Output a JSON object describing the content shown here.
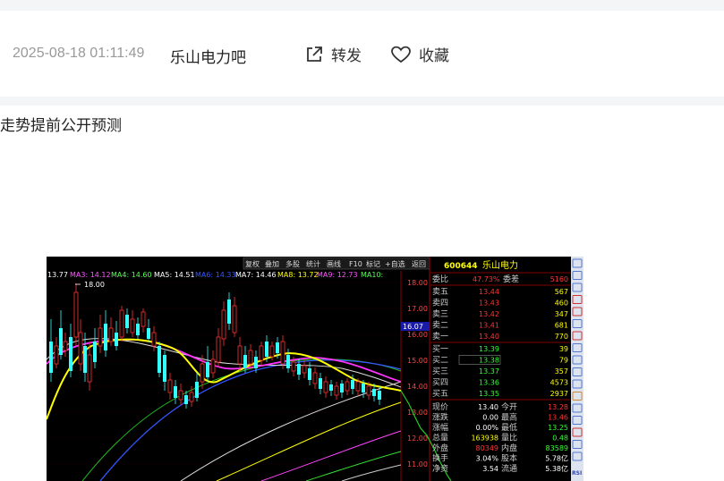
{
  "post": {
    "timestamp": "2025-08-18 01:11:49",
    "author": "乐山电力吧",
    "share_label": "转发",
    "favorite_label": "收藏",
    "text": "走势提前公开预测"
  },
  "stock_panel": {
    "toolbar": [
      "复权",
      "叠加",
      "多股",
      "统计",
      "画线",
      "F10",
      "标记",
      "+自选",
      "返回"
    ],
    "ma_legend": [
      {
        "label": "13.77",
        "color": "#ffffff"
      },
      {
        "label": "MA3: 14.12",
        "color": "#ff55ff"
      },
      {
        "label": "MA4: 14.60",
        "color": "#55ff55"
      },
      {
        "label": "MA5: 14.51",
        "color": "#ffffff"
      },
      {
        "label": "MA6: 14.33",
        "color": "#3355ff"
      },
      {
        "label": "MA7: 14.46",
        "color": "#ffffff"
      },
      {
        "label": "MA8: 13.72",
        "color": "#ffff00"
      },
      {
        "label": "MA9: 12.73",
        "color": "#ff55ff"
      },
      {
        "label": "MA10:",
        "color": "#55ff55"
      }
    ],
    "peak_label": "18.00",
    "current_price_tag": "16.07",
    "y_ticks": [
      "18.00",
      "17.00",
      "16.00",
      "15.00",
      "14.00",
      "13.00",
      "12.00",
      "11.00"
    ],
    "code": "600644",
    "name": "乐山电力",
    "weibi": {
      "label": "委比",
      "value": "47.73%",
      "label2": "委差",
      "value2": "5160"
    },
    "asks": [
      {
        "label": "卖五",
        "price": "13.44",
        "vol": "567"
      },
      {
        "label": "卖四",
        "price": "13.43",
        "vol": "460"
      },
      {
        "label": "卖三",
        "price": "13.42",
        "vol": "347"
      },
      {
        "label": "卖二",
        "price": "13.41",
        "vol": "681"
      },
      {
        "label": "卖一",
        "price": "13.40",
        "vol": "770"
      }
    ],
    "bids": [
      {
        "label": "买一",
        "price": "13.39",
        "vol": "39"
      },
      {
        "label": "买二",
        "price": "13.38",
        "vol": "79"
      },
      {
        "label": "买三",
        "price": "13.37",
        "vol": "357"
      },
      {
        "label": "买四",
        "price": "13.36",
        "vol": "4573"
      },
      {
        "label": "买五",
        "price": "13.35",
        "vol": "2937"
      }
    ],
    "stats": [
      {
        "l1": "现价",
        "v1": "13.40",
        "l2": "今开",
        "v2": "13.28"
      },
      {
        "l1": "涨跌",
        "v1": "0.00",
        "l2": "最高",
        "v2": "13.46"
      },
      {
        "l1": "涨幅",
        "v1": "0.00%",
        "l2": "最低",
        "v2": "13.25"
      },
      {
        "l1": "总量",
        "v1": "163938",
        "l2": "量比",
        "v2": "0.48"
      },
      {
        "l1": "外盘",
        "v1": "80349",
        "l2": "内盘",
        "v2": "83589"
      },
      {
        "l1": "换手",
        "v1": "3.04%",
        "l2": "股本",
        "v2": "5.78亿"
      },
      {
        "l1": "净资",
        "v1": "3.54",
        "l2": "流通",
        "v2": "5.38亿"
      }
    ],
    "side_label": "RSI",
    "colors": {
      "up": "#ff3333",
      "down": "#33ffff",
      "ask": "#ff3333",
      "bid": "#33ff33",
      "header": "#ffff00",
      "bg": "#000000"
    }
  }
}
